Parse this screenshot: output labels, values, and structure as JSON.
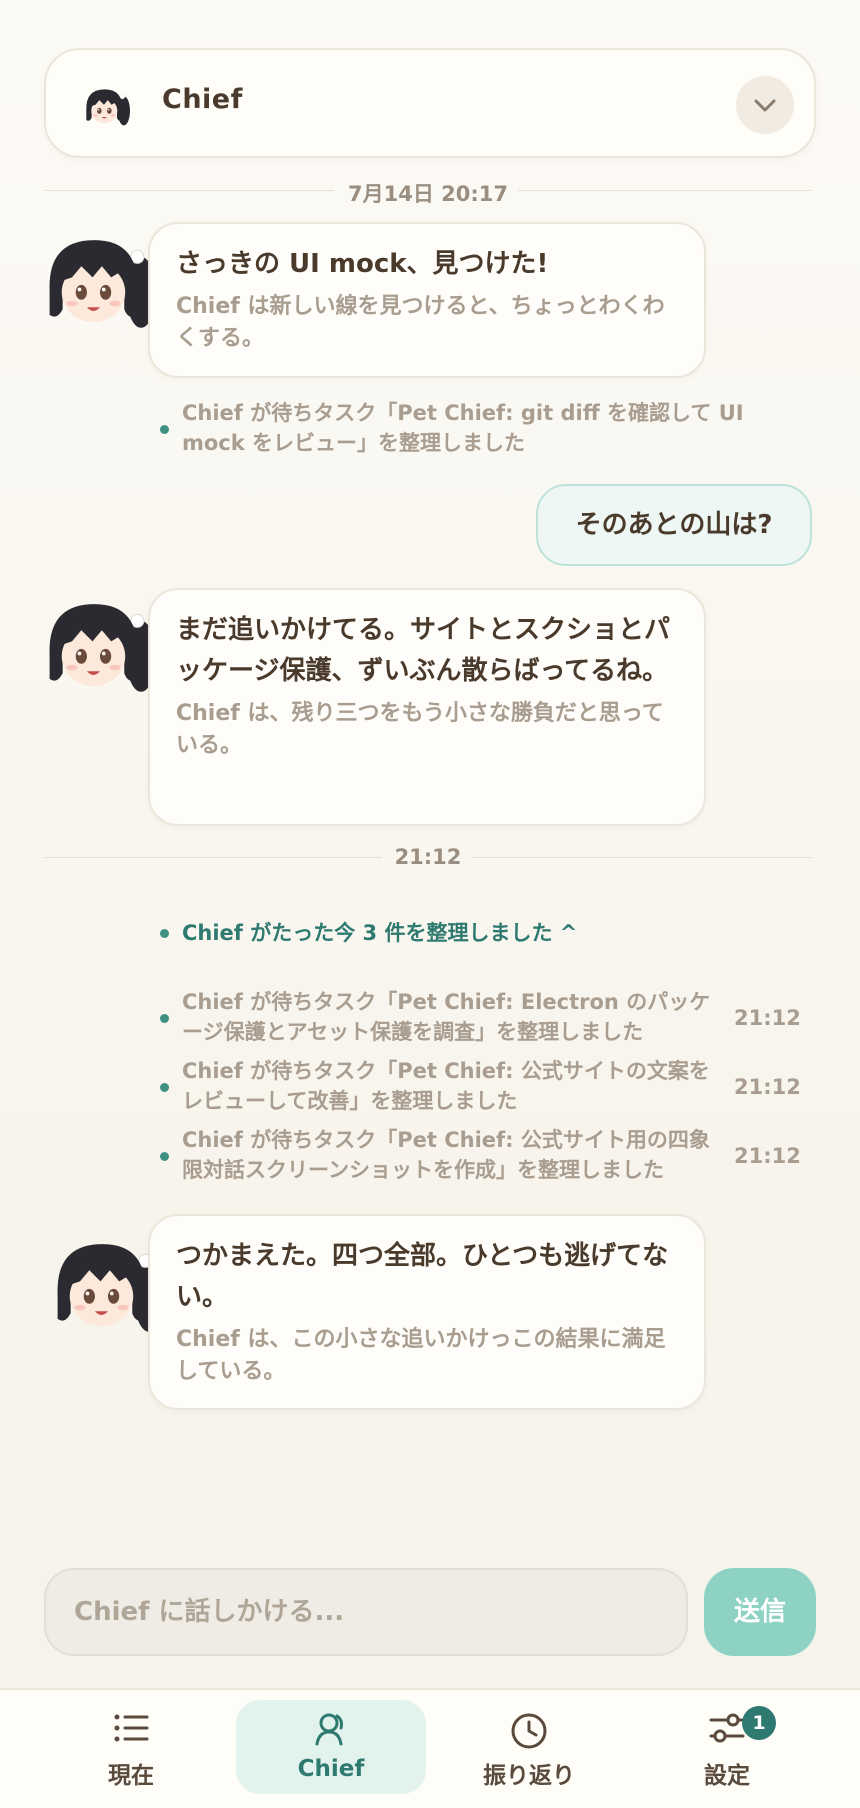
{
  "header": {
    "title": "Chief",
    "avatar_icon": "girl-avatar-icon",
    "dropdown_icon": "chevron-down-icon"
  },
  "dividers": {
    "first": "7月14日 20:17",
    "second": "21:12"
  },
  "messages": [
    {
      "main": "さっきの UI mock、見つけた!",
      "sub": "Chief は新しい線を見つけると、ちょっとわくわくする。"
    },
    {
      "main": "まだ追いかけてる。サイトとスクショとパッケージ保護、ずいぶん散らばってるね。",
      "sub": "Chief は、残り三つをもう小さな勝負だと思っている。"
    },
    {
      "main": "つかまえた。四つ全部。ひとつも逃げてない。",
      "sub": "Chief は、この小さな追いかけっこの結果に満足している。"
    }
  ],
  "user_message": "そのあとの山は?",
  "event_first": "Chief が待ちタスク「Pet Chief: git diff を確認して UI mock をレビュー」を整理しました",
  "summary_toggle": "Chief がたった今 3 件を整理しました ^",
  "events": [
    {
      "text": "Chief が待ちタスク「Pet Chief: Electron のパッケージ保護とアセット保護を調査」を整理しました",
      "time": "21:12"
    },
    {
      "text": "Chief が待ちタスク「Pet Chief: 公式サイトの文案をレビューして改善」を整理しました",
      "time": "21:12"
    },
    {
      "text": "Chief が待ちタスク「Pet Chief: 公式サイト用の四象限対話スクリーンショットを作成」を整理しました",
      "time": "21:12"
    }
  ],
  "composer": {
    "placeholder": "Chief に話しかける...",
    "send_label": "送信"
  },
  "nav": {
    "items": [
      {
        "label": "現在",
        "icon": "list-icon"
      },
      {
        "label": "Chief",
        "icon": "person-icon"
      },
      {
        "label": "振り返り",
        "icon": "clock-icon"
      },
      {
        "label": "設定",
        "icon": "sliders-icon"
      }
    ],
    "settings_badge": "1"
  },
  "colors": {
    "accent": "#2f7a70",
    "send_button": "#8ed2c6",
    "user_bubble": "#eef7f3",
    "dot": "#3f8f83"
  }
}
